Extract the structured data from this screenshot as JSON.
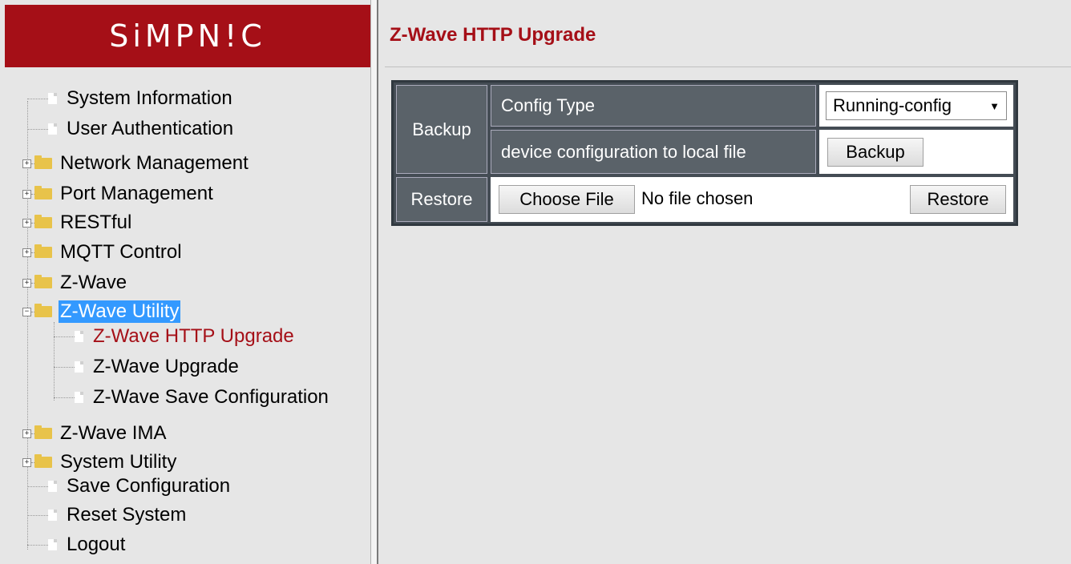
{
  "brand": {
    "logo_text": "SiMPN!C",
    "color": "#a50f17"
  },
  "sidebar": {
    "items": [
      {
        "label": "System Information",
        "type": "page"
      },
      {
        "label": "User Authentication",
        "type": "page"
      },
      {
        "label": "Network Management",
        "type": "folder",
        "expander": "+"
      },
      {
        "label": "Port Management",
        "type": "folder",
        "expander": "+"
      },
      {
        "label": "RESTful",
        "type": "folder",
        "expander": "+"
      },
      {
        "label": "MQTT Control",
        "type": "folder",
        "expander": "+"
      },
      {
        "label": "Z-Wave",
        "type": "folder",
        "expander": "+"
      },
      {
        "label": "Z-Wave Utility",
        "type": "folder",
        "expander": "−",
        "selected": true
      },
      {
        "label": "Z-Wave HTTP Upgrade",
        "type": "page",
        "current": true
      },
      {
        "label": "Z-Wave Upgrade",
        "type": "page"
      },
      {
        "label": "Z-Wave Save Configuration",
        "type": "page"
      },
      {
        "label": "Z-Wave IMA",
        "type": "folder",
        "expander": "+"
      },
      {
        "label": "System Utility",
        "type": "folder",
        "expander": "+"
      },
      {
        "label": "Save Configuration",
        "type": "page"
      },
      {
        "label": "Reset System",
        "type": "page"
      },
      {
        "label": "Logout",
        "type": "page"
      }
    ]
  },
  "main": {
    "title": "Z-Wave HTTP Upgrade",
    "backup": {
      "label": "Backup",
      "config_type_label": "Config Type",
      "config_type_value": "Running-config",
      "dest_label": "device configuration to local file",
      "button": "Backup"
    },
    "restore": {
      "label": "Restore",
      "choose_button": "Choose File",
      "file_status": "No file chosen",
      "button": "Restore"
    }
  }
}
